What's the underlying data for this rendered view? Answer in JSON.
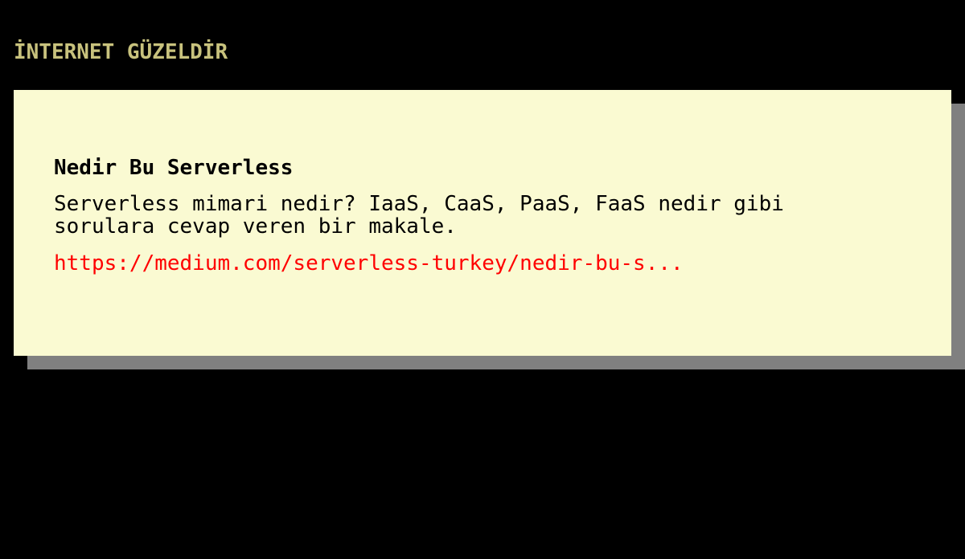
{
  "site": {
    "title": "İNTERNET GÜZELDİR"
  },
  "card": {
    "title": "Nedir Bu Serverless",
    "description": "Serverless mimari nedir? IaaS, CaaS, PaaS, FaaS nedir gibi sorulara cevap veren bir makale.",
    "link_text": "https://medium.com/serverless-turkey/nedir-bu-s..."
  },
  "colors": {
    "background": "#000000",
    "site_title": "#c8c27d",
    "card_background": "#fafad2",
    "card_shadow": "#808080",
    "link": "#ff0000"
  }
}
